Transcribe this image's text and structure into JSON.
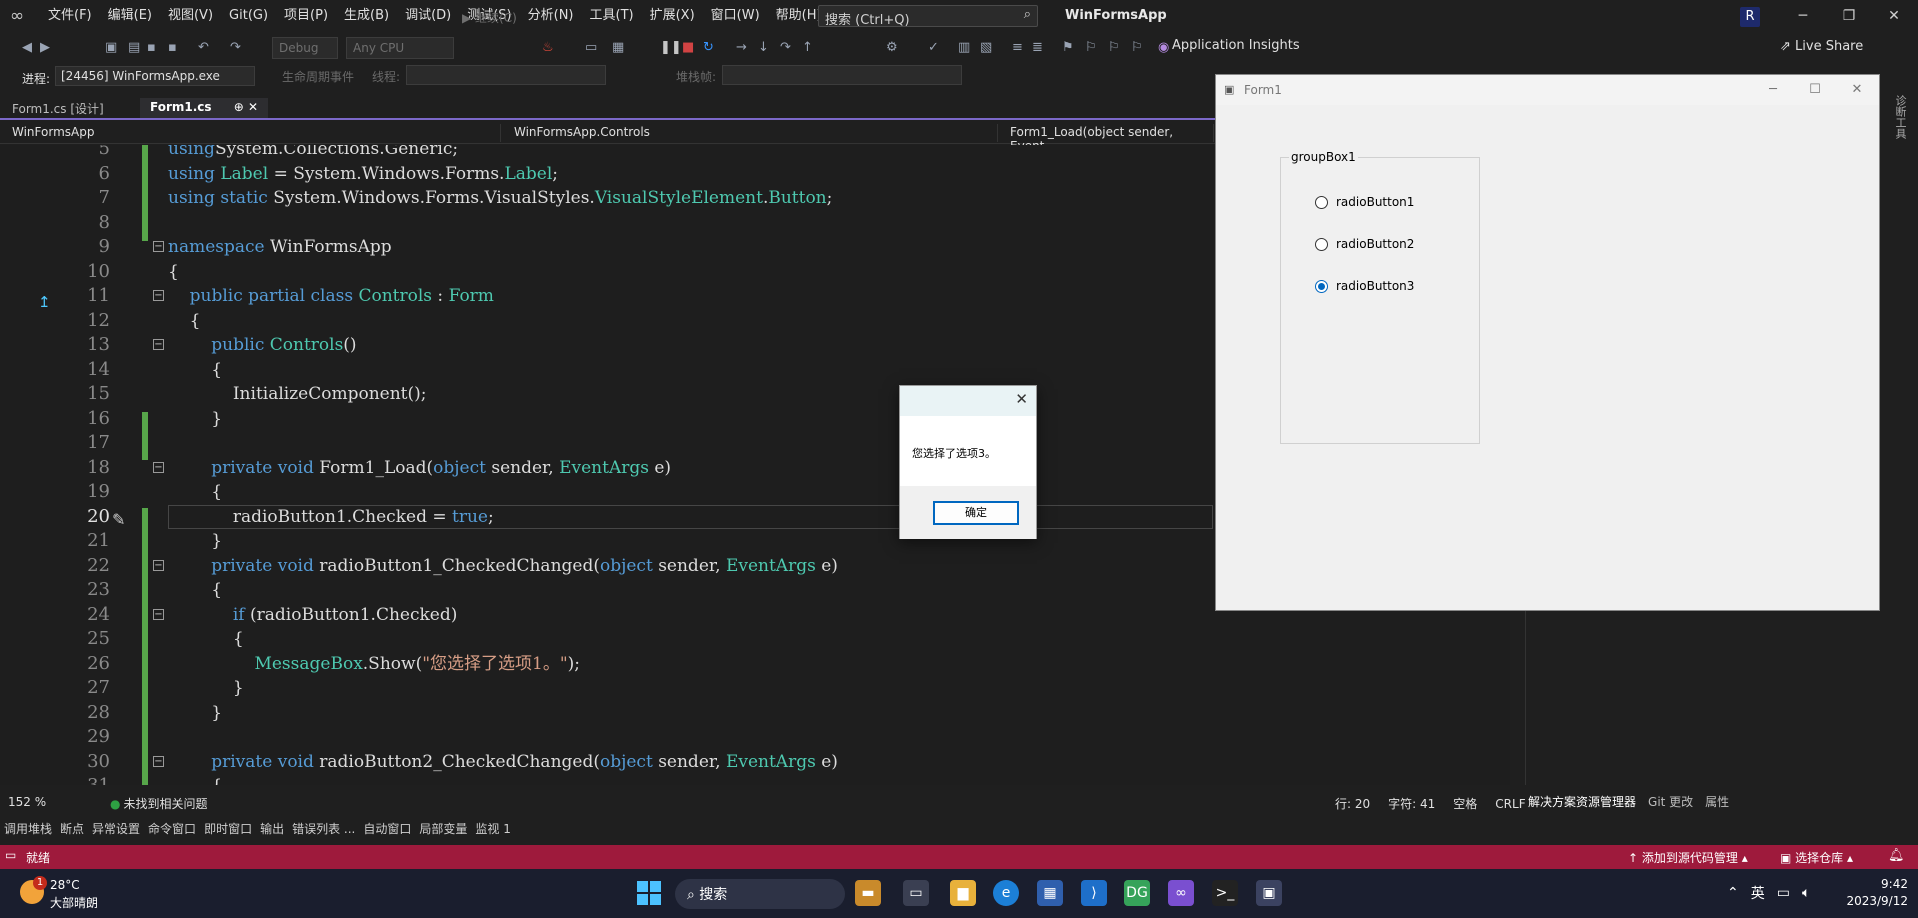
{
  "menu": {
    "items": [
      "文件(F)",
      "编辑(E)",
      "视图(V)",
      "Git(G)",
      "项目(P)",
      "生成(B)",
      "调试(D)",
      "测试(S)",
      "分析(N)",
      "工具(T)",
      "扩展(X)",
      "窗口(W)",
      "帮助(H)"
    ],
    "search_text": "搜索 (Ctrl+Q)",
    "app_title": "WinFormsApp",
    "user_initial": "R"
  },
  "toolbar": {
    "config": "Debug",
    "platform": "Any CPU",
    "continue_label": "继续(C)",
    "app_insights": "Application Insights",
    "live_share": "Live Share"
  },
  "debugbar": {
    "process_label": "进程:",
    "process_value": "[24456] WinFormsApp.exe",
    "lifecycle": "生命周期事件",
    "thread": "线程:",
    "stack": "堆栈帧:"
  },
  "tabs": {
    "designer": "Form1.cs [设计]",
    "code": "Form1.cs"
  },
  "navbar": {
    "project": "WinFormsApp",
    "namespace": "WinFormsApp.Controls",
    "member": "Form1_Load(object sender, Event"
  },
  "editor": {
    "current_line": 20,
    "lines": [
      {
        "n": "5",
        "t": [
          [
            "kw",
            "using"
          ],
          [
            "",
            "System.Collections.Generic;"
          ]
        ]
      },
      {
        "n": "6",
        "t": [
          [
            "kw",
            "using"
          ],
          [
            "ty",
            " Label"
          ],
          [
            "",
            " = System.Windows.Forms."
          ],
          [
            "ty",
            "Label"
          ],
          [
            "",
            ";"
          ]
        ]
      },
      {
        "n": "7",
        "t": [
          [
            "kw",
            "using static"
          ],
          [
            "",
            " System.Windows.Forms.VisualStyles."
          ],
          [
            "ty",
            "VisualStyleElement"
          ],
          [
            "",
            "."
          ],
          [
            "ty",
            "Button"
          ],
          [
            "",
            ";"
          ]
        ]
      },
      {
        "n": "8",
        "t": []
      },
      {
        "n": "9",
        "t": [
          [
            "kw",
            "namespace"
          ],
          [
            "",
            " WinFormsApp"
          ]
        ]
      },
      {
        "n": "10",
        "t": [
          [
            "",
            "{"
          ]
        ]
      },
      {
        "n": "11",
        "t": [
          [
            "",
            "    "
          ],
          [
            "kw",
            "public partial class"
          ],
          [
            "ty",
            " Controls"
          ],
          [
            "",
            " : "
          ],
          [
            "ty",
            "Form"
          ]
        ]
      },
      {
        "n": "12",
        "t": [
          [
            "",
            "    {"
          ]
        ]
      },
      {
        "n": "13",
        "t": [
          [
            "",
            "        "
          ],
          [
            "kw",
            "public"
          ],
          [
            "ty",
            " Controls"
          ],
          [
            "",
            "()"
          ]
        ]
      },
      {
        "n": "14",
        "t": [
          [
            "",
            "        {"
          ]
        ]
      },
      {
        "n": "15",
        "t": [
          [
            "",
            "            InitializeComponent();"
          ]
        ]
      },
      {
        "n": "16",
        "t": [
          [
            "",
            "        }"
          ]
        ]
      },
      {
        "n": "17",
        "t": []
      },
      {
        "n": "18",
        "t": [
          [
            "",
            "        "
          ],
          [
            "kw",
            "private void"
          ],
          [
            "",
            " Form1_Load("
          ],
          [
            "kw",
            "object"
          ],
          [
            "",
            " sender, "
          ],
          [
            "ty",
            "EventArgs"
          ],
          [
            "",
            " e)"
          ]
        ]
      },
      {
        "n": "19",
        "t": [
          [
            "",
            "        {"
          ]
        ]
      },
      {
        "n": "20",
        "t": [
          [
            "",
            "            radioButton1.Checked = "
          ],
          [
            "kw",
            "true"
          ],
          [
            "",
            ";"
          ]
        ]
      },
      {
        "n": "21",
        "t": [
          [
            "",
            "        }"
          ]
        ]
      },
      {
        "n": "22",
        "t": [
          [
            "",
            "        "
          ],
          [
            "kw",
            "private void"
          ],
          [
            "",
            " radioButton1_CheckedChanged("
          ],
          [
            "kw",
            "object"
          ],
          [
            "",
            " sender, "
          ],
          [
            "ty",
            "EventArgs"
          ],
          [
            "",
            " e)"
          ]
        ]
      },
      {
        "n": "23",
        "t": [
          [
            "",
            "        {"
          ]
        ]
      },
      {
        "n": "24",
        "t": [
          [
            "",
            "            "
          ],
          [
            "kw",
            "if"
          ],
          [
            "",
            " (radioButton1.Checked)"
          ]
        ]
      },
      {
        "n": "25",
        "t": [
          [
            "",
            "            {"
          ]
        ]
      },
      {
        "n": "26",
        "t": [
          [
            "",
            "                "
          ],
          [
            "ty",
            "MessageBox"
          ],
          [
            "",
            ".Show("
          ],
          [
            "str",
            "\"您选择了选项1。\""
          ],
          [
            "",
            ");"
          ]
        ]
      },
      {
        "n": "27",
        "t": [
          [
            "",
            "            }"
          ]
        ]
      },
      {
        "n": "28",
        "t": [
          [
            "",
            "        }"
          ]
        ]
      },
      {
        "n": "29",
        "t": []
      },
      {
        "n": "30",
        "t": [
          [
            "",
            "        "
          ],
          [
            "kw",
            "private void"
          ],
          [
            "",
            " radioButton2_CheckedChanged("
          ],
          [
            "kw",
            "object"
          ],
          [
            "",
            " sender, "
          ],
          [
            "ty",
            "EventArgs"
          ],
          [
            "",
            " e)"
          ]
        ]
      },
      {
        "n": "31",
        "t": [
          [
            "",
            "        {"
          ]
        ]
      }
    ]
  },
  "form1": {
    "caption": "Form1",
    "groupbox_label": "groupBox1",
    "radios": [
      {
        "label": "radioButton1",
        "checked": false
      },
      {
        "label": "radioButton2",
        "checked": false
      },
      {
        "label": "radioButton3",
        "checked": true
      }
    ]
  },
  "msgbox": {
    "text": "您选择了选项3。",
    "ok_label": "确定"
  },
  "status": {
    "zoom": "152 %",
    "issues": "未找到相关问题",
    "line": "行: 20",
    "col": "字符: 41",
    "space": "空格",
    "eol": "CRLF"
  },
  "rightpanel": {
    "tabs": [
      "解决方案资源管理器",
      "Git 更改",
      "属性"
    ],
    "side_label": "诊断工具"
  },
  "tooltabs": [
    "调用堆栈",
    "断点",
    "异常设置",
    "命令窗口",
    "即时窗口",
    "输出",
    "错误列表 ...",
    "自动窗口",
    "局部变量",
    "监视 1"
  ],
  "statusbar": {
    "ready": "就绪",
    "add_source": "添加到源代码管理",
    "select_repo": "选择仓库"
  },
  "taskbar": {
    "weather_badge": "1",
    "temp": "28°C",
    "weather": "大部晴朗",
    "search": "搜索",
    "ime": "英",
    "time": "9:42",
    "date": "2023/9/12"
  }
}
